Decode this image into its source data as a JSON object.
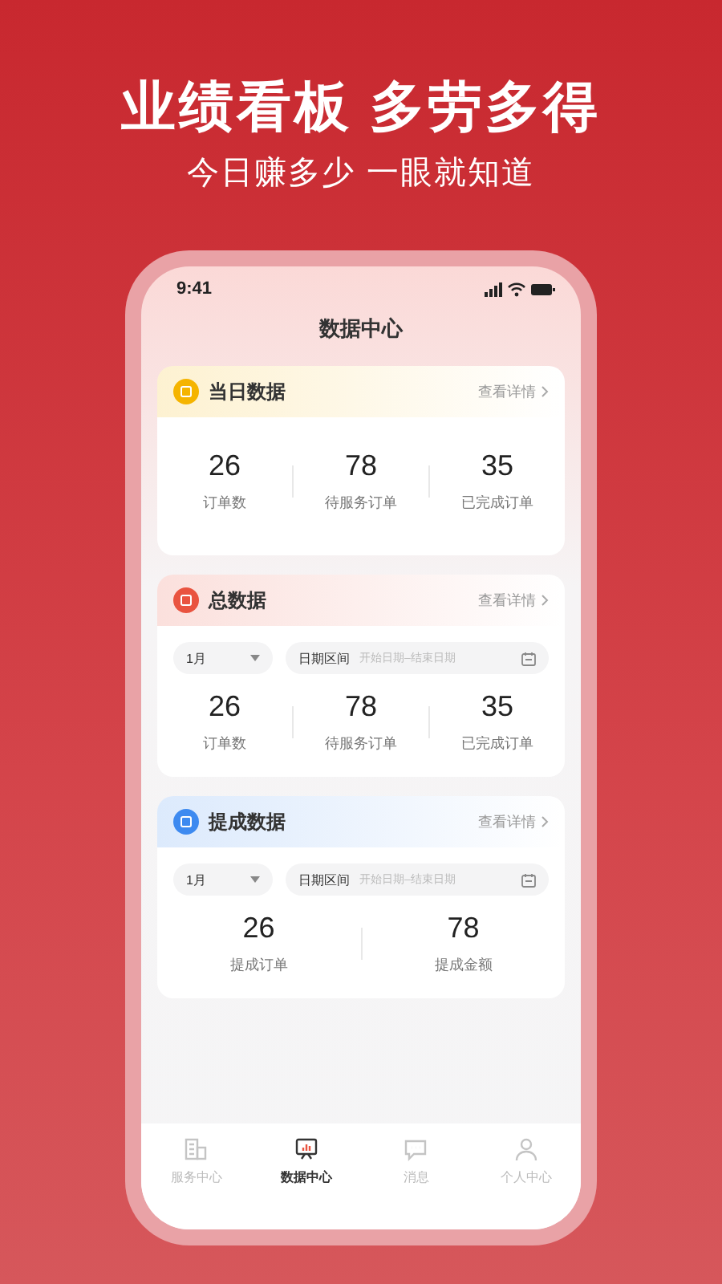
{
  "headline": "业绩看板 多劳多得",
  "subheadline": "今日赚多少 一眼就知道",
  "status_bar": {
    "time": "9:41"
  },
  "page_title": "数据中心",
  "cards": [
    {
      "title": "当日数据",
      "color": "#f5b400",
      "link": "查看详情",
      "stats": [
        {
          "value": "26",
          "label": "订单数"
        },
        {
          "value": "78",
          "label": "待服务订单"
        },
        {
          "value": "35",
          "label": "已完成订单"
        }
      ]
    },
    {
      "title": "总数据",
      "color": "#e9533f",
      "link": "查看详情",
      "filters": {
        "month": "1月",
        "range_label": "日期区间",
        "placeholder": "开始日期–结束日期"
      },
      "stats": [
        {
          "value": "26",
          "label": "订单数"
        },
        {
          "value": "78",
          "label": "待服务订单"
        },
        {
          "value": "35",
          "label": "已完成订单"
        }
      ]
    },
    {
      "title": "提成数据",
      "color": "#3d8af0",
      "link": "查看详情",
      "filters": {
        "month": "1月",
        "range_label": "日期区间",
        "placeholder": "开始日期–结束日期"
      },
      "stats": [
        {
          "value": "26",
          "label": "提成订单"
        },
        {
          "value": "78",
          "label": "提成金额"
        }
      ]
    }
  ],
  "tab_bar": [
    {
      "label": "服务中心",
      "selected": false
    },
    {
      "label": "数据中心",
      "selected": true
    },
    {
      "label": "消息",
      "selected": false
    },
    {
      "label": "个人中心",
      "selected": false
    }
  ]
}
